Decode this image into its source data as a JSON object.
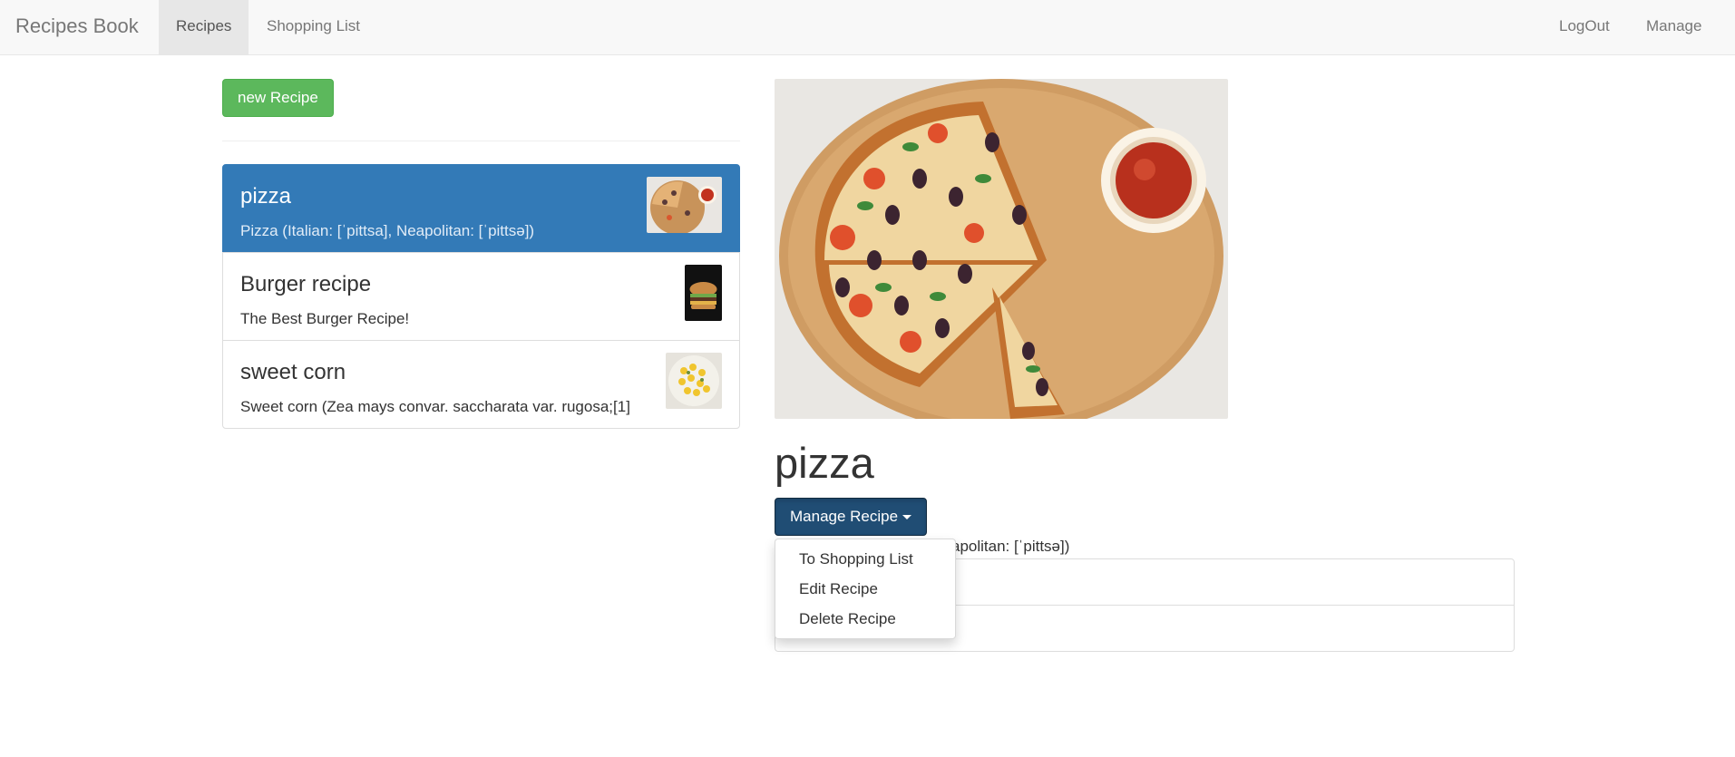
{
  "navbar": {
    "brand": "Recipes Book",
    "links": [
      {
        "label": "Recipes",
        "active": true
      },
      {
        "label": "Shopping List",
        "active": false
      }
    ],
    "right_links": [
      {
        "label": "LogOut"
      },
      {
        "label": "Manage"
      }
    ]
  },
  "sidebar": {
    "new_button_label": "new Recipe",
    "recipes": [
      {
        "title": "pizza",
        "description": "Pizza (Italian: [ˈpittsa], Neapolitan: [ˈpittsə])",
        "active": true,
        "image": "pizza-thumbnail"
      },
      {
        "title": "Burger recipe",
        "description": "The Best Burger Recipe!",
        "active": false,
        "image": "burger-thumbnail"
      },
      {
        "title": "sweet corn",
        "description": "Sweet corn (Zea mays convar. saccharata var. rugosa;[1]",
        "active": false,
        "image": "sweet-corn-thumbnail"
      }
    ]
  },
  "detail": {
    "title": "pizza",
    "manage_button_label": "Manage Recipe",
    "description": "Pizza (Italian: [ˈpittsa], Neapolitan: [ˈpittsə])",
    "description_visible": "apolitan: [ˈpittsə])",
    "ingredients": [
      "",
      ""
    ],
    "dropdown": [
      "To Shopping List",
      "Edit Recipe",
      "Delete Recipe"
    ]
  },
  "colors": {
    "primary": "#337ab7",
    "success": "#5cb85c",
    "manage_button": "#204d74",
    "navbar_bg": "#f8f8f8"
  }
}
